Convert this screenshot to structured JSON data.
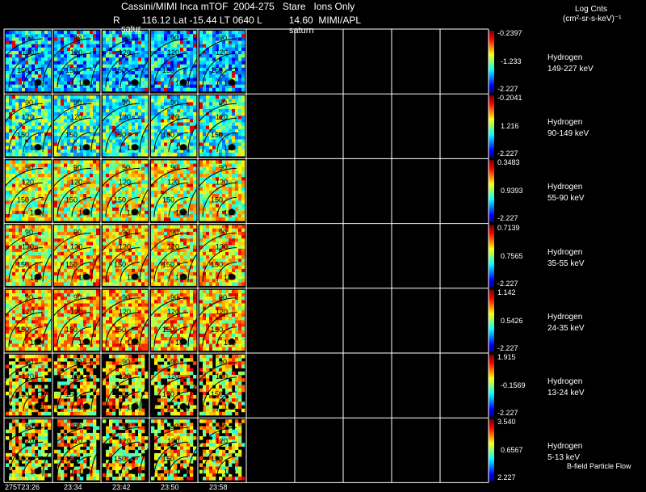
{
  "header": {
    "line1": "Cassini/MIMI Inca mTOF  2004-275   Stare   Ions Only",
    "line2": "R        116.12 Lat -15.44 LT 0640 L          14.60  MIMI/APL",
    "saturn_labels": [
      "satur",
      "saturn"
    ],
    "units_title": "Log Cnts",
    "units": "(cm²-sr-s-keV)⁻¹"
  },
  "contour_labels": [
    "90",
    "120",
    "150",
    "180"
  ],
  "bands": [
    {
      "species": "Hydrogen",
      "energy": "149-227 keV",
      "max": "-0.2397",
      "mid": "-1.233",
      "min": "-2.227"
    },
    {
      "species": "Hydrogen",
      "energy": "90-149 keV",
      "max": "-0.2041",
      "mid": "1.216",
      "min": "-2.227"
    },
    {
      "species": "Hydrogen",
      "energy": "55-90 keV",
      "max": "0.3483",
      "mid": "0.9393",
      "min": "-2.227"
    },
    {
      "species": "Hydrogen",
      "energy": "35-55 keV",
      "max": "0.7139",
      "mid": "0.7565",
      "min": "-2.227"
    },
    {
      "species": "Hydrogen",
      "energy": "24-35 keV",
      "max": "1.142",
      "mid": "0.5426",
      "min": "-2.227"
    },
    {
      "species": "Hydrogen",
      "energy": "13-24 keV",
      "max": "1.915",
      "mid": "-0.1569",
      "min": "-2.227"
    },
    {
      "species": "Hydrogen",
      "energy": "5-13 keV",
      "max": "3.540",
      "mid": "0.6567",
      "min": "2.227"
    }
  ],
  "time_labels": [
    "275T23:26",
    "23:34",
    "23:42",
    "23:50",
    "23:58"
  ],
  "footer_note": "B-field Particle Flow",
  "colors": {
    "background": "#000000",
    "grid": "#ffffff",
    "contour": "#000000"
  }
}
